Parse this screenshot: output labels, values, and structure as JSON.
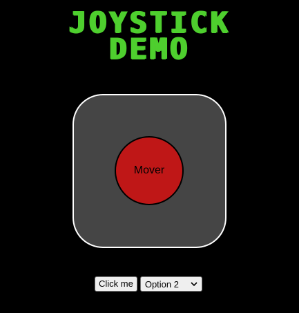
{
  "title": {
    "line1": "JOYSTICK",
    "line2": "DEMO"
  },
  "joystick": {
    "mover_label": "Mover"
  },
  "controls": {
    "button_label": "Click me",
    "select_value": "Option 2"
  },
  "colors": {
    "background": "#000000",
    "title": "#4ecf2e",
    "base": "#454545",
    "base_border": "#ffffff",
    "mover": "#bf1717"
  },
  "icons": {
    "select_arrow": "chevron-down-icon"
  }
}
